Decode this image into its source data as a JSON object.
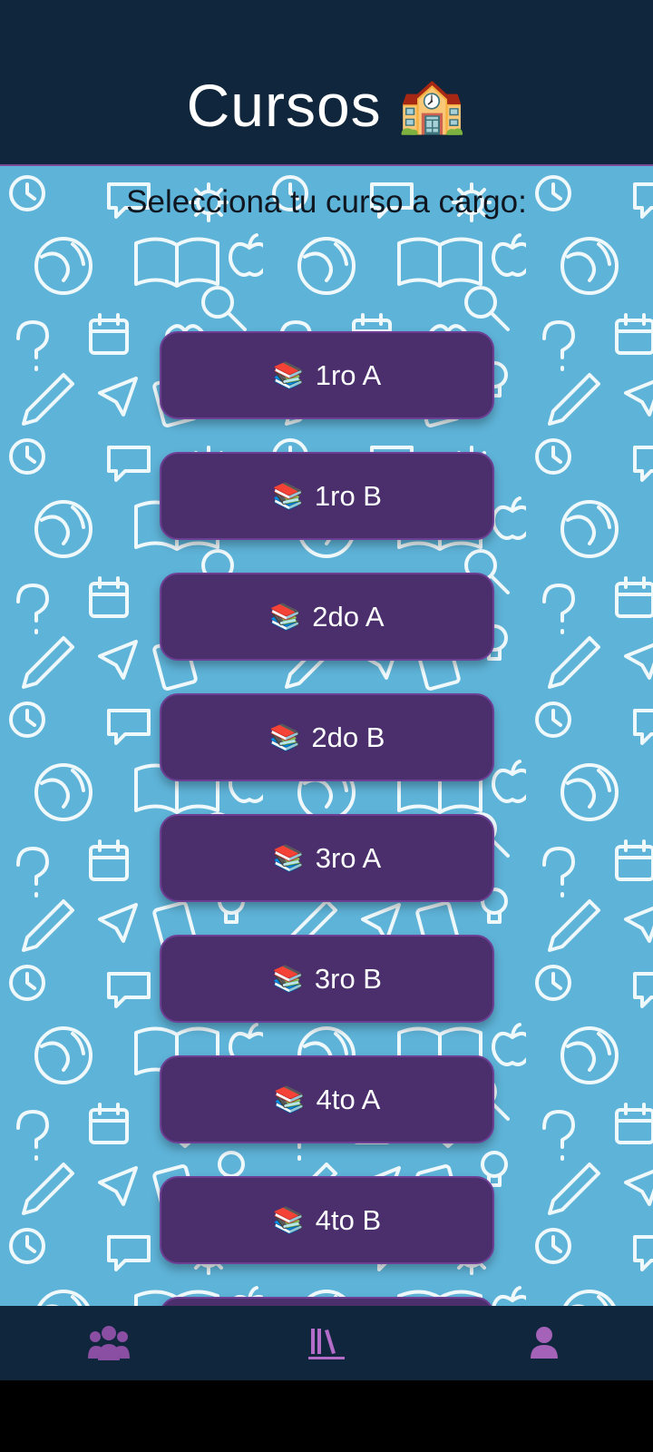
{
  "header": {
    "title": "Cursos",
    "title_emoji": "🏫"
  },
  "main": {
    "subtitle": "Selecciona tu curso a cargo:",
    "courses": [
      {
        "icon": "📚",
        "label": "1ro A"
      },
      {
        "icon": "📚",
        "label": "1ro B"
      },
      {
        "icon": "📚",
        "label": "2do A"
      },
      {
        "icon": "📚",
        "label": "2do B"
      },
      {
        "icon": "📚",
        "label": "3ro A"
      },
      {
        "icon": "📚",
        "label": "3ro B"
      },
      {
        "icon": "📚",
        "label": "4to A"
      },
      {
        "icon": "📚",
        "label": "4to B"
      }
    ]
  },
  "navbar": {
    "items": [
      {
        "icon": "users-icon"
      },
      {
        "icon": "library-icon",
        "active": true
      },
      {
        "icon": "user-icon"
      }
    ]
  },
  "colors": {
    "header_bg": "#10263c",
    "content_bg": "#5eb3d8",
    "button_bg": "#4b2f6c",
    "nav_icon": "#a463b8"
  }
}
